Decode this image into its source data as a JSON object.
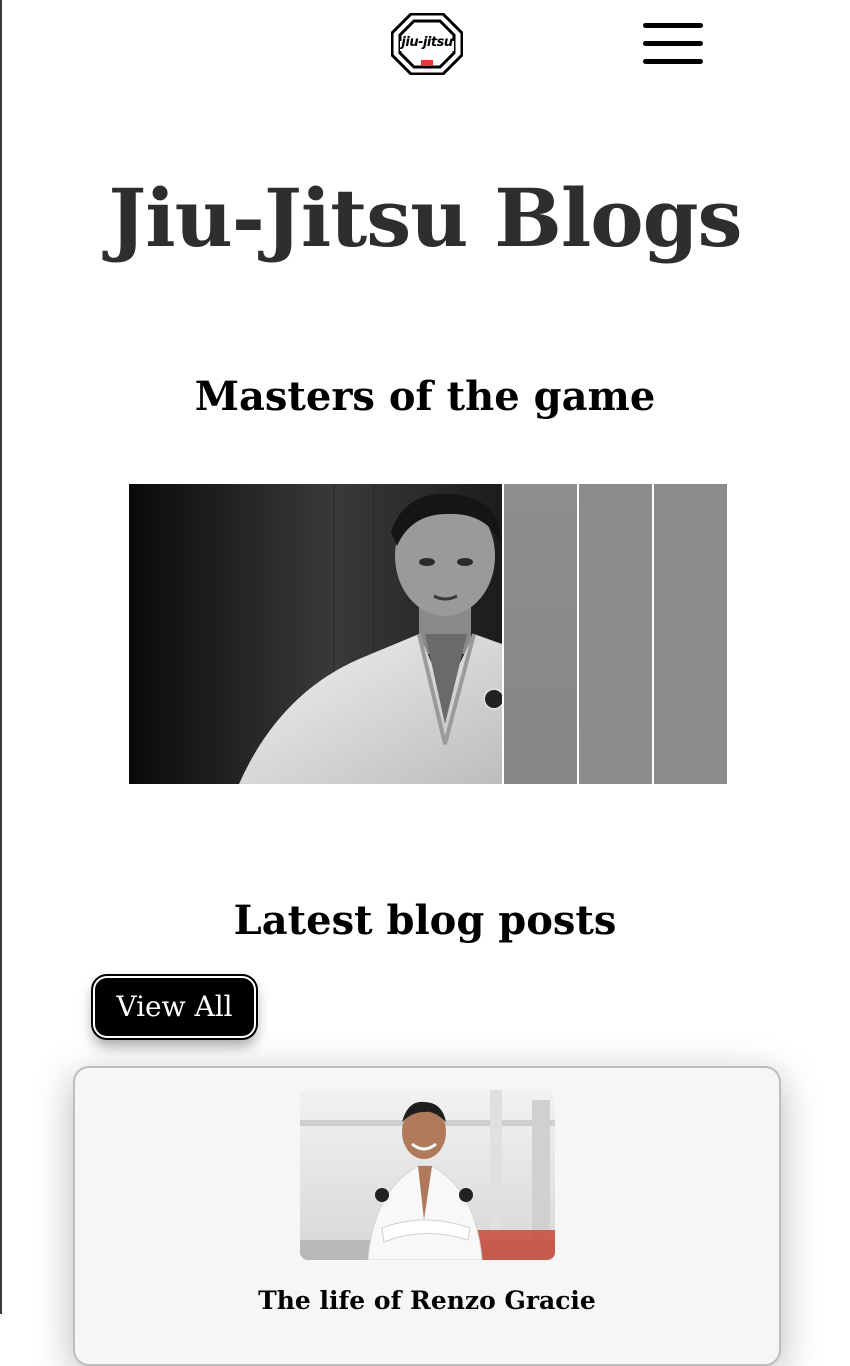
{
  "header": {
    "logo_text": "jiu-jitsu",
    "logo_icon": "octagon-logo-icon",
    "menu_icon": "hamburger-menu-icon"
  },
  "page_title": "Jiu-Jitsu Blogs",
  "masters_section": {
    "title": "Masters of the game",
    "gallery": {
      "featured_image": "black-and-white portrait of man in white gi",
      "strip_count_note": ""
    }
  },
  "latest_section": {
    "title": "Latest blog posts",
    "view_all_label": "View All",
    "posts": [
      {
        "title": "The life of Renzo Gracie"
      }
    ]
  },
  "colors": {
    "title_text": "#2e2e2e",
    "button_bg": "#000000",
    "button_text": "#ffffff",
    "card_bg": "#f6f6f6",
    "gallery_strip": "#8b8b8b",
    "logo_accent": "#e53935"
  }
}
